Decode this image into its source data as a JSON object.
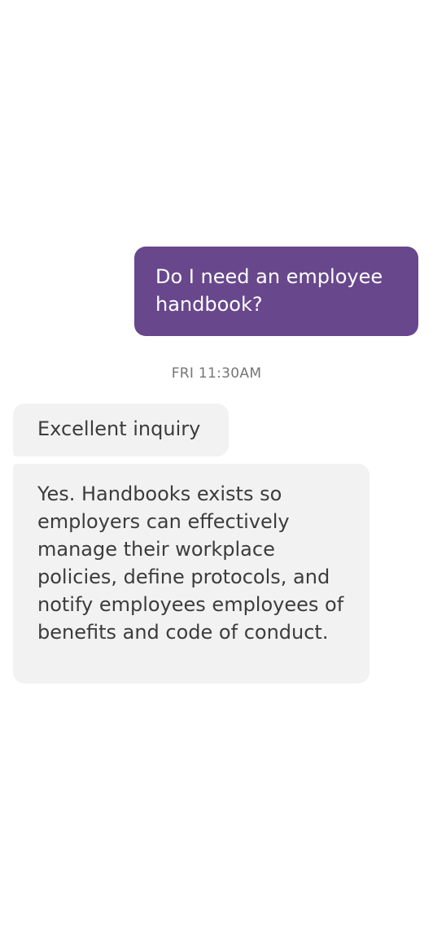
{
  "conversation": {
    "messages": [
      {
        "direction": "outgoing",
        "text": "Do I need an employee handbook?"
      },
      {
        "direction": "incoming",
        "text": "Excellent inquiry"
      },
      {
        "direction": "incoming",
        "text": "Yes. Handbooks exists so employers can effectively manage their workplace policies, define protocols, and notify employees employees of benefits and code of conduct."
      }
    ],
    "timestamp": "FRI 11:30AM"
  },
  "colors": {
    "outgoing_bubble": "#68478c",
    "incoming_bubble": "#f2f2f2",
    "outgoing_text": "#ffffff",
    "incoming_text": "#3c3c3c",
    "timestamp_text": "#757575"
  }
}
